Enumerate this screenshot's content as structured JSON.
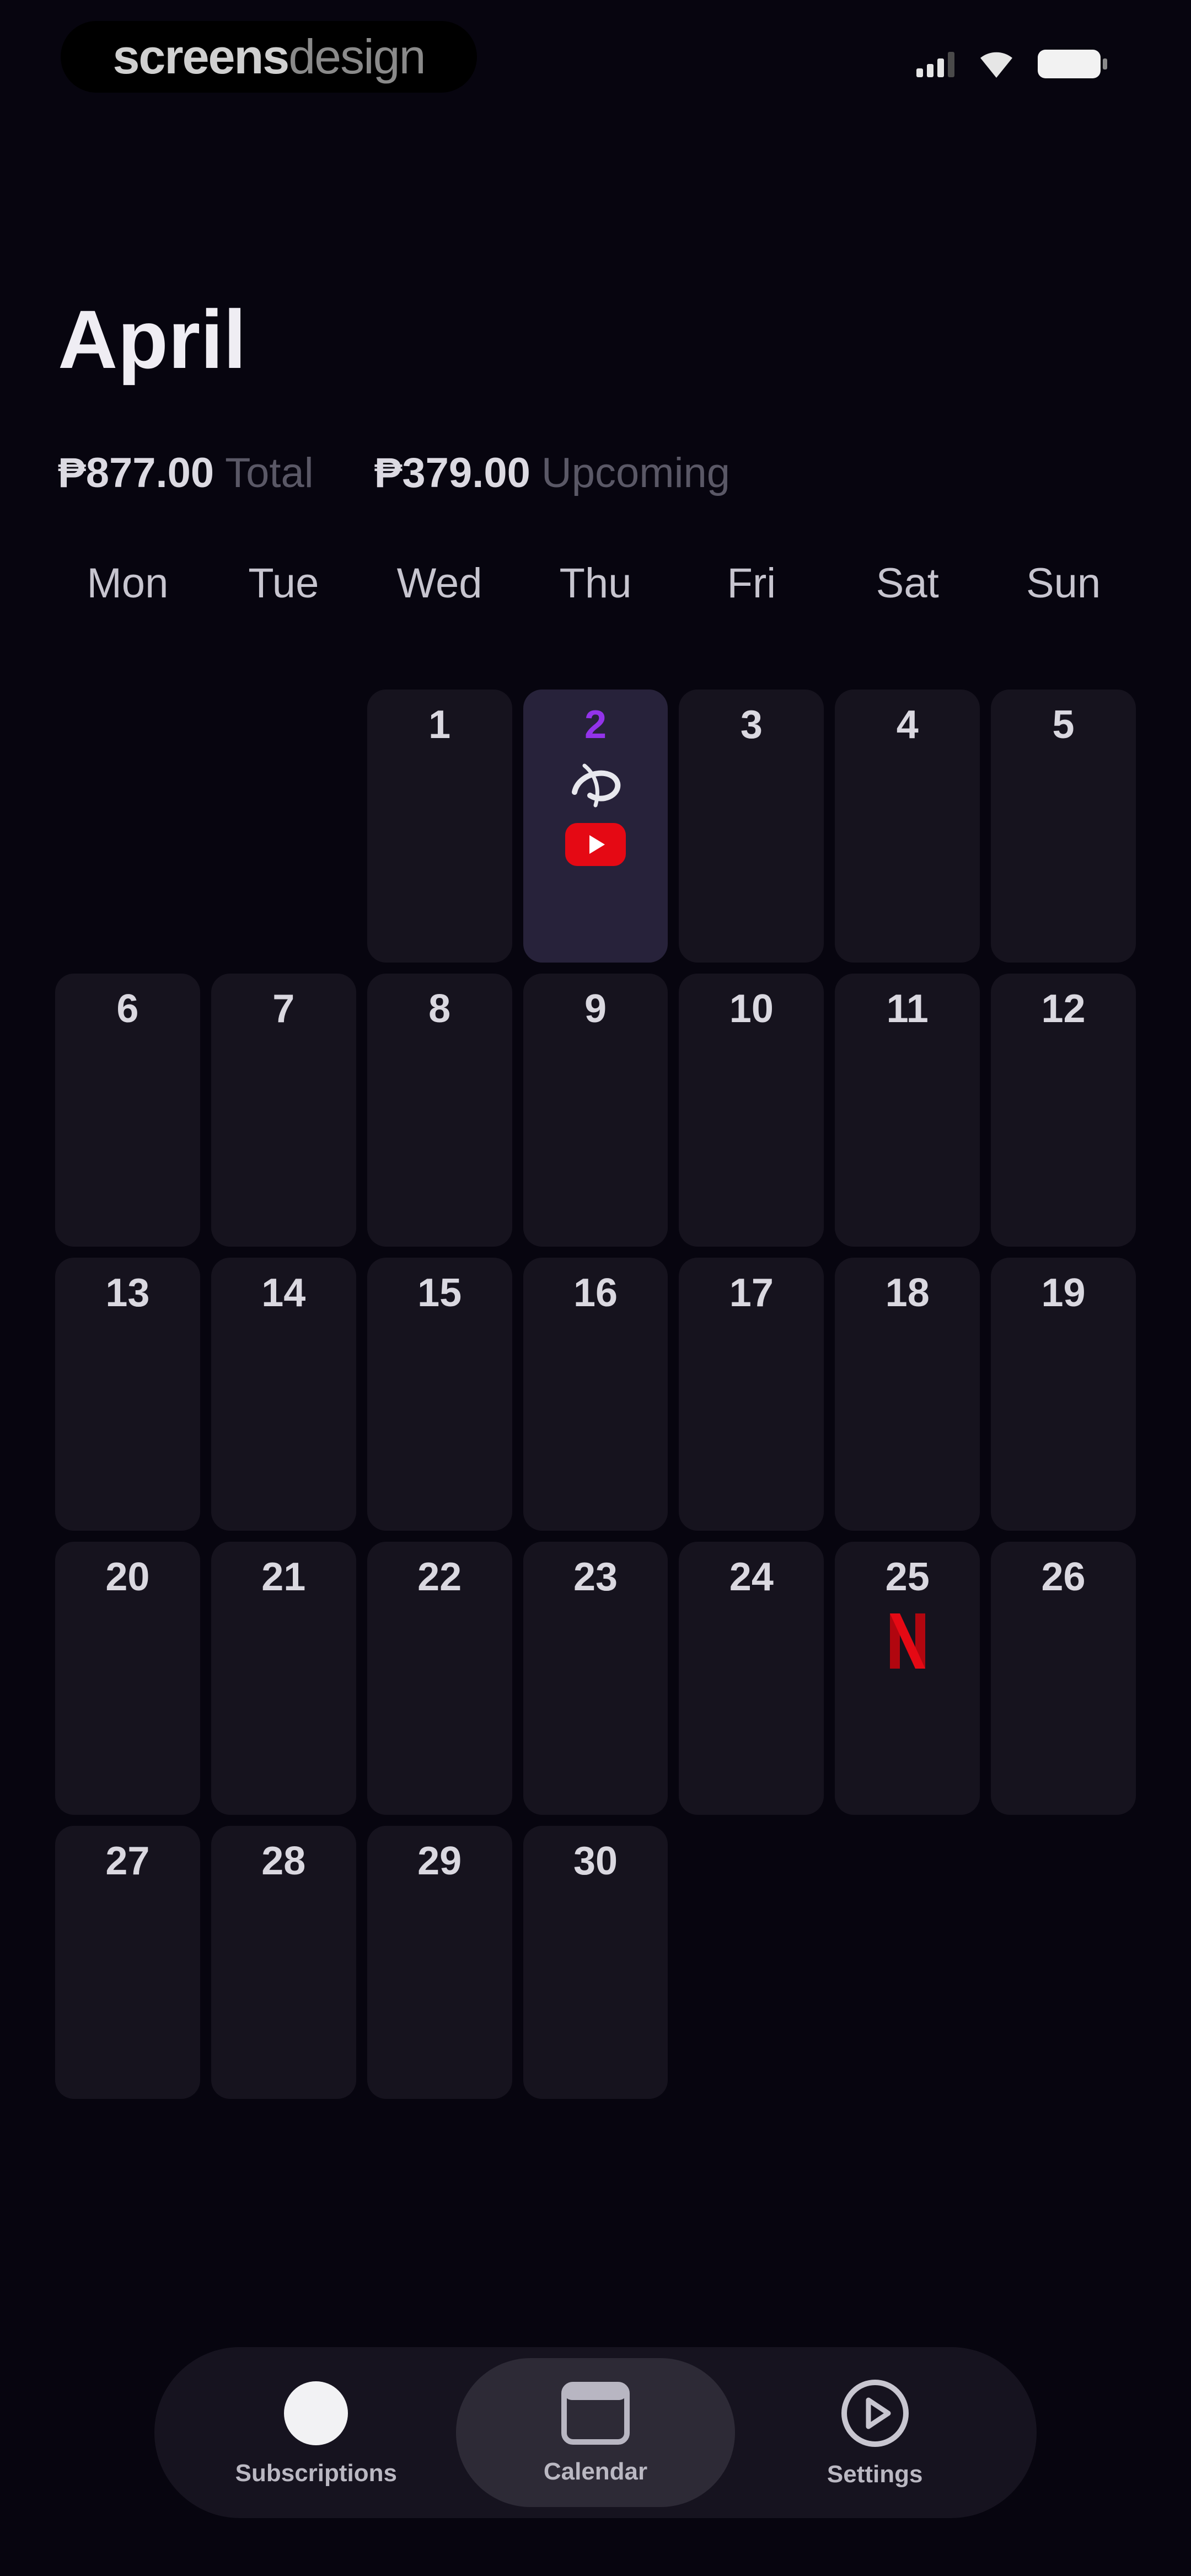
{
  "status_bar": {
    "brand_part1": "screens",
    "brand_part2": "design",
    "icons": [
      "cellular-signal-icon",
      "wifi-icon",
      "battery-icon"
    ]
  },
  "header": {
    "month": "April",
    "total_amount": "₱877.00",
    "total_label": "Total",
    "upcoming_amount": "₱379.00",
    "upcoming_label": "Upcoming"
  },
  "weekdays": [
    "Mon",
    "Tue",
    "Wed",
    "Thu",
    "Fri",
    "Sat",
    "Sun"
  ],
  "calendar": {
    "leading_empty_days": 2,
    "today": 2,
    "days": [
      {
        "label": "1"
      },
      {
        "label": "2",
        "events": [
          "disney-plus-icon",
          "youtube-icon"
        ]
      },
      {
        "label": "3"
      },
      {
        "label": "4"
      },
      {
        "label": "5"
      },
      {
        "label": "6"
      },
      {
        "label": "7"
      },
      {
        "label": "8"
      },
      {
        "label": "9"
      },
      {
        "label": "10"
      },
      {
        "label": "11"
      },
      {
        "label": "12"
      },
      {
        "label": "13"
      },
      {
        "label": "14"
      },
      {
        "label": "15"
      },
      {
        "label": "16"
      },
      {
        "label": "17"
      },
      {
        "label": "18"
      },
      {
        "label": "19"
      },
      {
        "label": "20"
      },
      {
        "label": "21"
      },
      {
        "label": "22"
      },
      {
        "label": "23"
      },
      {
        "label": "24"
      },
      {
        "label": "25",
        "events": [
          "netflix-icon"
        ]
      },
      {
        "label": "26"
      },
      {
        "label": "27"
      },
      {
        "label": "28"
      },
      {
        "label": "29"
      },
      {
        "label": "30"
      }
    ]
  },
  "tab_bar": {
    "tabs": [
      {
        "label": "Subscriptions",
        "icon": "subscriptions-circle-icon",
        "active": false
      },
      {
        "label": "Calendar",
        "icon": "calendar-icon",
        "active": true
      },
      {
        "label": "Settings",
        "icon": "settings-play-icon",
        "active": false
      }
    ]
  },
  "colors": {
    "background": "#07050f",
    "cell": "#16131e",
    "today_cell": "#27223a",
    "today_number": "#9333ea",
    "youtube_red": "#e50914",
    "netflix_red": "#e50914"
  }
}
